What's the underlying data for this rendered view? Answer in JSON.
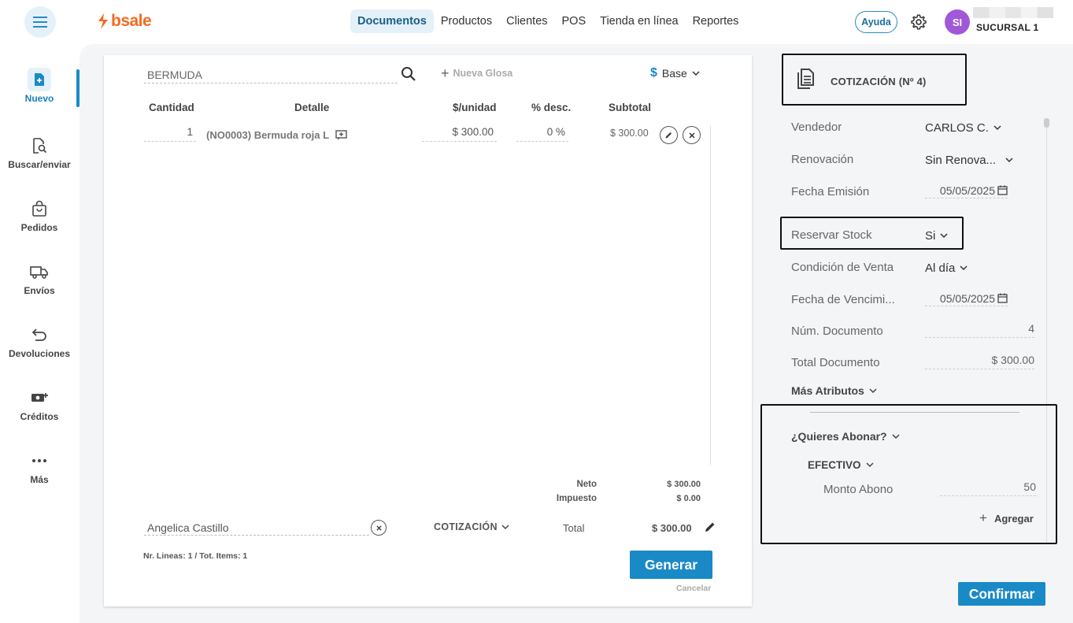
{
  "header": {
    "logo_text": "bsale",
    "nav": [
      "Documentos",
      "Productos",
      "Clientes",
      "POS",
      "Tienda en línea",
      "Reportes"
    ],
    "active_nav": "Documentos",
    "help_label": "Ayuda",
    "avatar_initials": "SI",
    "branch": "SUCURSAL 1"
  },
  "sidebar": {
    "items": [
      {
        "label": "Nuevo",
        "icon": "new-document-icon"
      },
      {
        "label": "Buscar/enviar",
        "icon": "search-document-icon"
      },
      {
        "label": "Pedidos",
        "icon": "shopping-bag-icon"
      },
      {
        "label": "Envíos",
        "icon": "truck-icon"
      },
      {
        "label": "Devoluciones",
        "icon": "return-arrow-icon"
      },
      {
        "label": "Créditos",
        "icon": "cash-plus-icon"
      },
      {
        "label": "Más",
        "icon": "more-dots-icon"
      }
    ]
  },
  "document": {
    "search_value": "BERMUDA",
    "nueva_glosa": "Nueva Glosa",
    "price_list": "Base",
    "columns": [
      "Cantidad",
      "Detalle",
      "$/unidad",
      "% desc.",
      "Subtotal"
    ],
    "lines": [
      {
        "cantidad": "1",
        "detalle": "(NO0003) Bermuda roja L",
        "unit_price": "$ 300.00",
        "discount": "0 %",
        "subtotal": "$ 300.00"
      }
    ],
    "neto_label": "Neto",
    "neto_value": "$ 300.00",
    "impuesto_label": "Impuesto",
    "impuesto_value": "$ 0.00",
    "client": "Angelica Castillo",
    "doc_type": "COTIZACIÓN",
    "total_label": "Total",
    "total_value": "$ 300.00",
    "lines_info": "Nr. Lineas: 1 / Tot. Items: 1",
    "generate_label": "Generar",
    "cancel_label": "Cancelar"
  },
  "panel": {
    "title": "COTIZACIÓN (Nº 4)",
    "vendedor_label": "Vendedor",
    "vendedor_value": "CARLOS C.",
    "renovacion_label": "Renovación",
    "renovacion_value": "Sin Renova...",
    "fecha_emision_label": "Fecha Emisión",
    "fecha_emision_value": "05/05/2025",
    "reservar_label": "Reservar Stock",
    "reservar_value": "Si",
    "condicion_label": "Condición de Venta",
    "condicion_value": "Al día",
    "vencimiento_label": "Fecha de Vencimi...",
    "vencimiento_value": "05/05/2025",
    "num_doc_label": "Núm. Documento",
    "num_doc_value": "4",
    "total_doc_label": "Total Documento",
    "total_doc_value": "$ 300.00",
    "mas_atributos": "Más Atributos",
    "abonar_label": "¿Quieres Abonar?",
    "payment_method": "EFECTIVO",
    "monto_label": "Monto Abono",
    "monto_value": "50",
    "agregar_label": "Agregar",
    "confirm_label": "Confirmar"
  },
  "colors": {
    "brand_orange": "#f26b21",
    "accent_blue": "#1a8ac7",
    "avatar_purple": "#a058d8"
  }
}
